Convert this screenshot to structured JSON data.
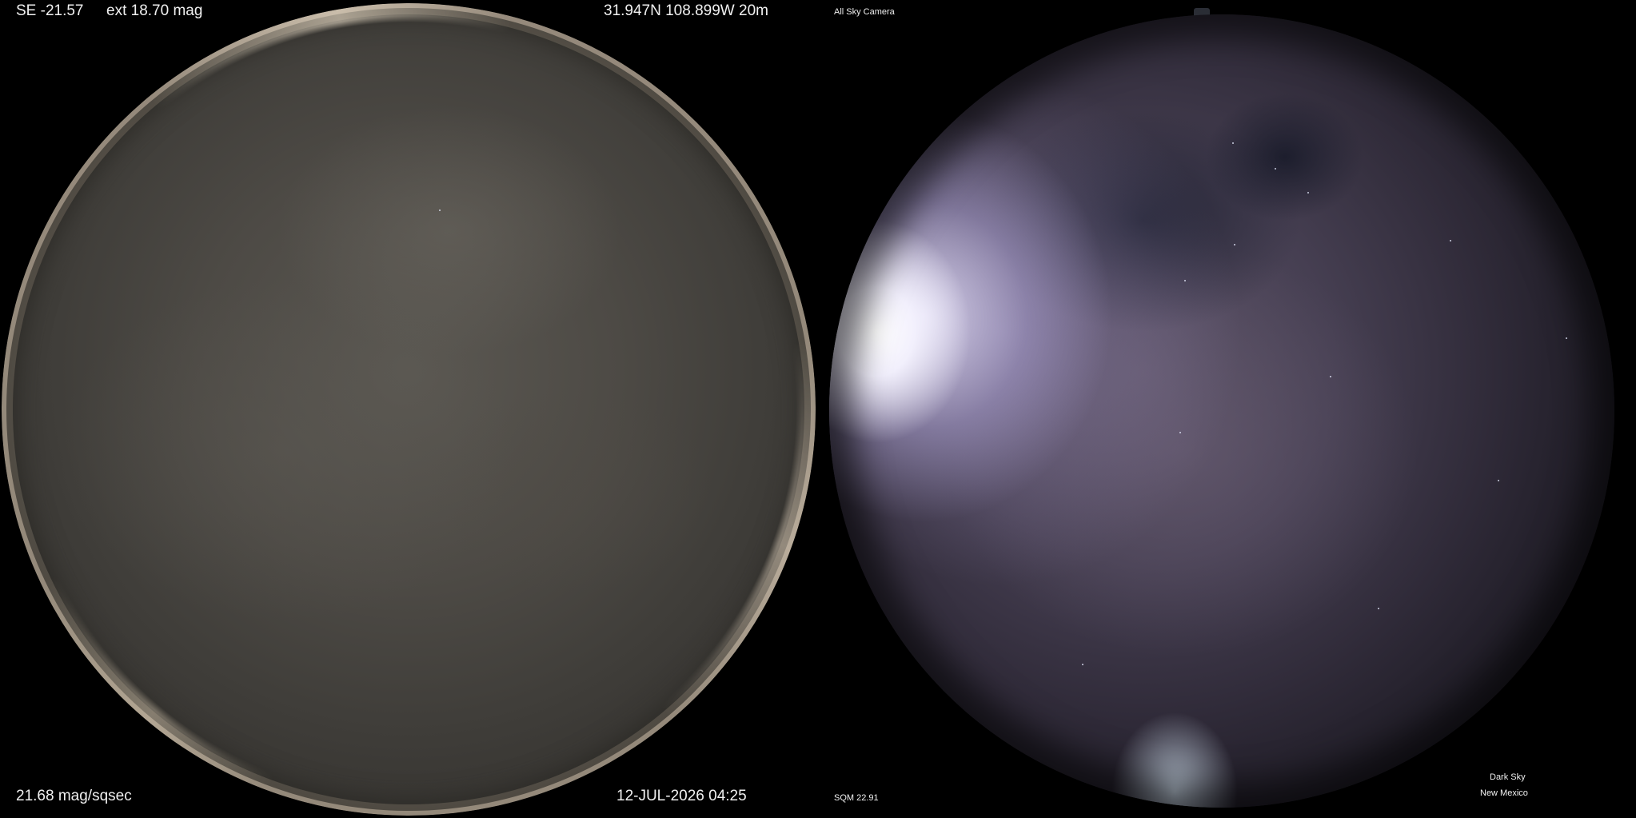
{
  "left_panel": {
    "top_left_line1": "SE -21.57",
    "top_left_line2": "ext 18.70 mag",
    "top_right": "31.947N 108.899W 20m",
    "bottom_left": "21.68 mag/sqsec",
    "bottom_right": "12-JUL-2026 04:25"
  },
  "right_panel": {
    "title": "All Sky Camera",
    "sqm": "SQM 22.91",
    "site_line1": "Dark Sky",
    "site_line2": "New Mexico"
  }
}
